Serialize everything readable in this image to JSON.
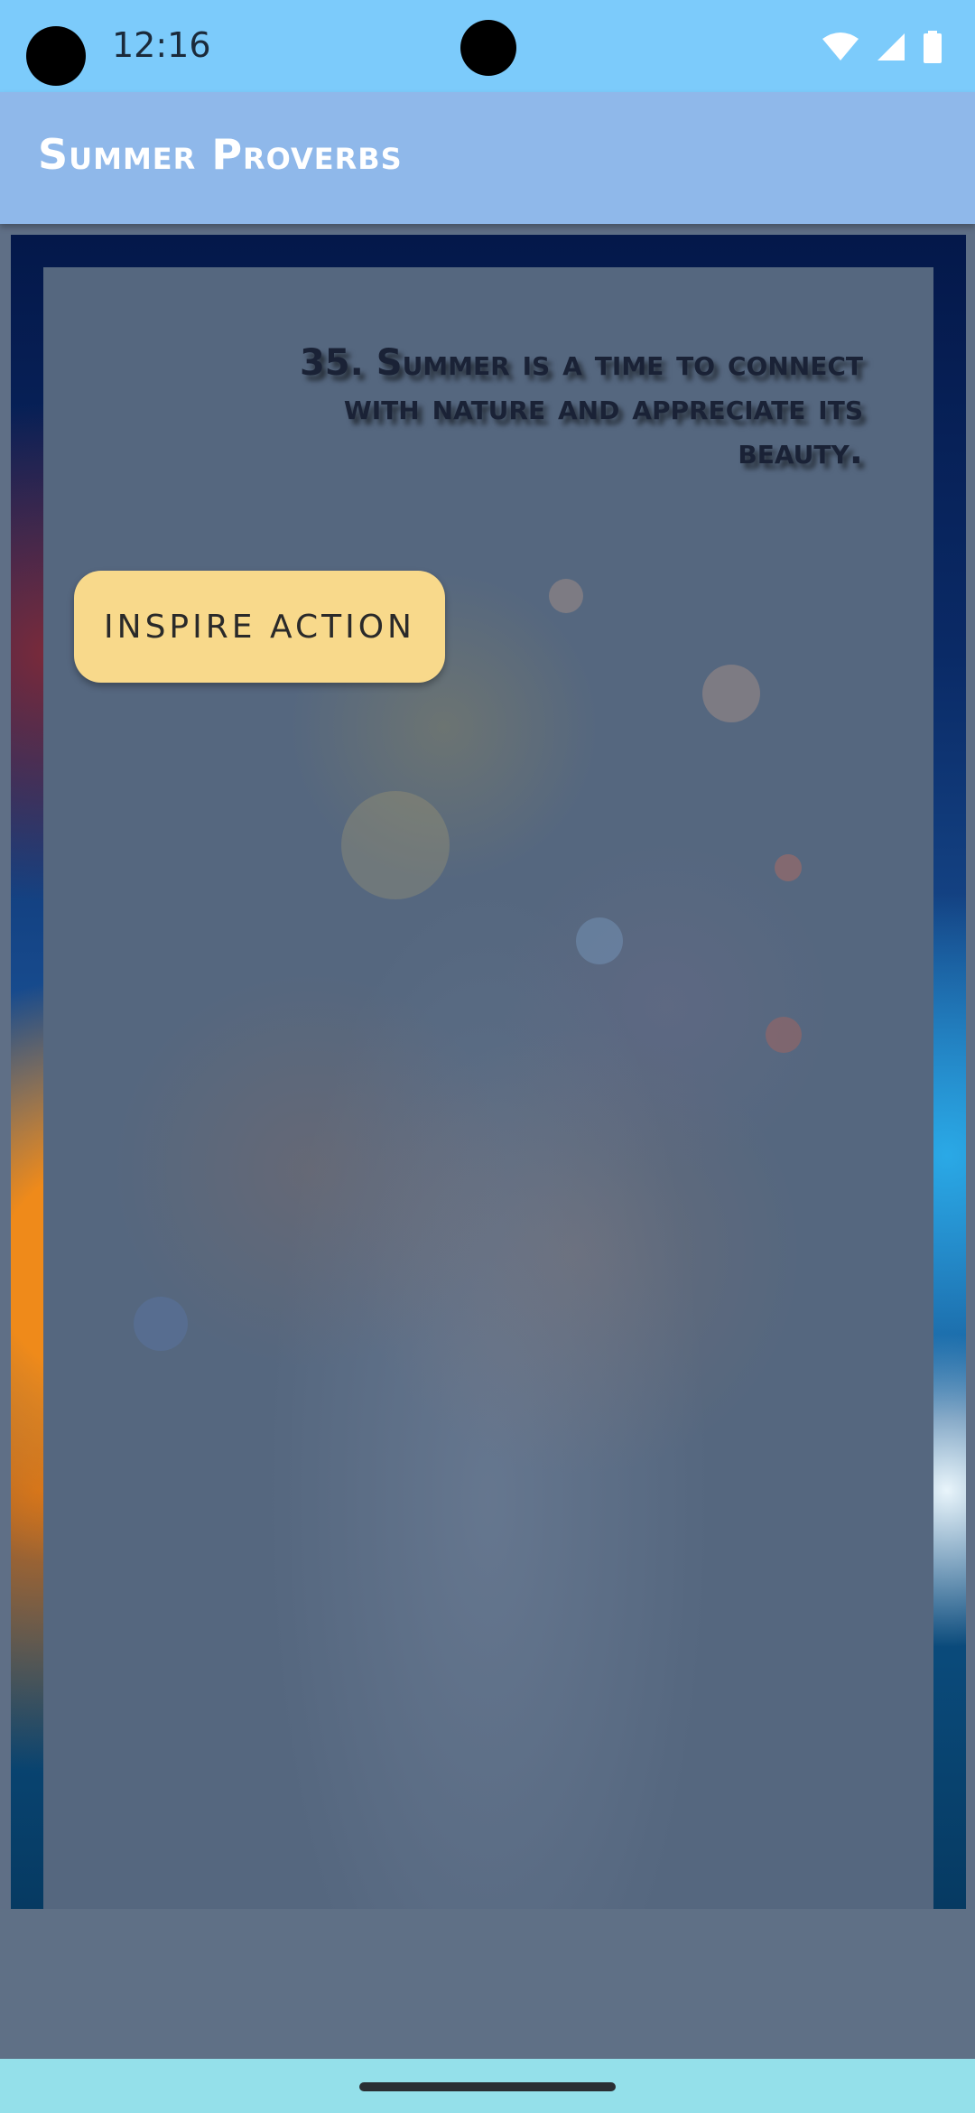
{
  "status_bar": {
    "time": "12:16",
    "icons": [
      "wifi-icon",
      "cell-signal-icon",
      "battery-icon"
    ]
  },
  "app_bar": {
    "title": "Summer Proverbs"
  },
  "content": {
    "proverb": "35. Summer is a time to connect with nature and appreciate its beauty.",
    "button_label": "INSPIRE ACTION"
  },
  "colors": {
    "status_bar": "#7ccbfb",
    "app_bar": "#8fb8ea",
    "button": "#f8d98b",
    "nav_bar": "#94e0ea"
  }
}
